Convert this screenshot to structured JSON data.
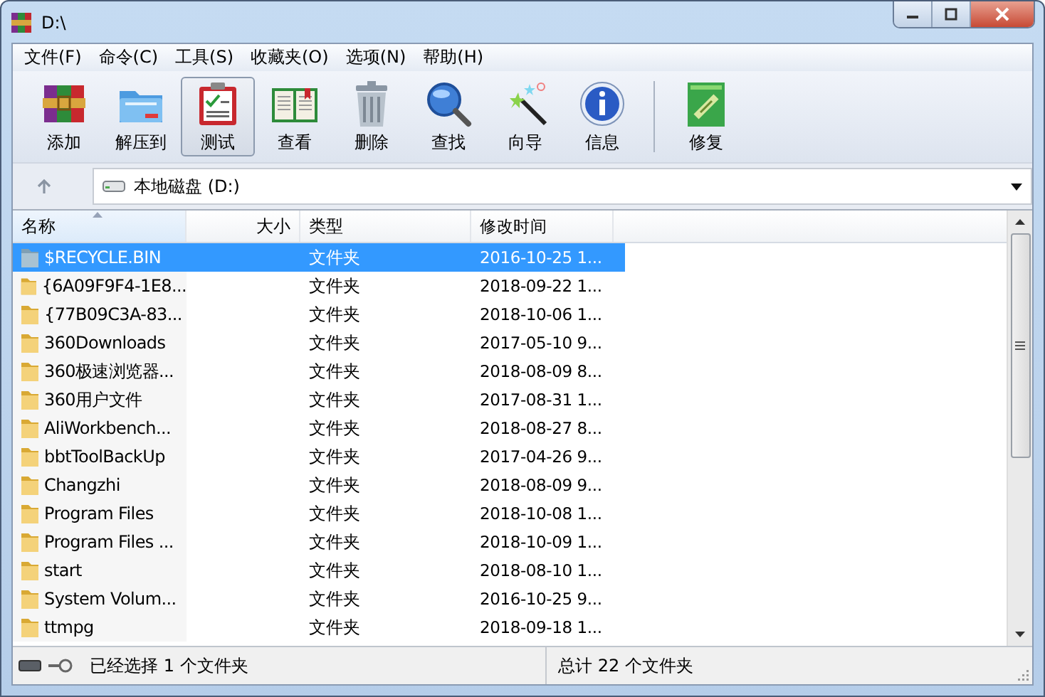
{
  "window": {
    "title": "D:\\"
  },
  "menu": [
    "文件(F)",
    "命令(C)",
    "工具(S)",
    "收藏夹(O)",
    "选项(N)",
    "帮助(H)"
  ],
  "toolbar": [
    {
      "label": "添加",
      "kind": "add",
      "selected": false
    },
    {
      "label": "解压到",
      "kind": "extract",
      "selected": false
    },
    {
      "label": "测试",
      "kind": "test",
      "selected": true
    },
    {
      "label": "查看",
      "kind": "view",
      "selected": false
    },
    {
      "label": "删除",
      "kind": "delete",
      "selected": false
    },
    {
      "label": "查找",
      "kind": "find",
      "selected": false
    },
    {
      "label": "向导",
      "kind": "wizard",
      "selected": false
    },
    {
      "label": "信息",
      "kind": "info",
      "selected": false
    },
    {
      "label": "修复",
      "kind": "repair",
      "selected": false
    }
  ],
  "address": {
    "value": "本地磁盘 (D:)"
  },
  "table": {
    "columns": [
      {
        "label": "名称",
        "sorted": true
      },
      {
        "label": "大小",
        "sorted": false
      },
      {
        "label": "类型",
        "sorted": false
      },
      {
        "label": "修改时间",
        "sorted": false
      }
    ],
    "rows": [
      {
        "name": "$RECYCLE.BIN",
        "kind": "recycle",
        "type": "文件夹",
        "modified": "2016-10-25 1...",
        "selected": true
      },
      {
        "name": "{6A09F9F4-1E8...",
        "kind": "folder",
        "type": "文件夹",
        "modified": "2018-09-22 1...",
        "selected": false
      },
      {
        "name": "{77B09C3A-83...",
        "kind": "folder",
        "type": "文件夹",
        "modified": "2018-10-06 1...",
        "selected": false
      },
      {
        "name": "360Downloads",
        "kind": "folder",
        "type": "文件夹",
        "modified": "2017-05-10 9...",
        "selected": false
      },
      {
        "name": "360极速浏览器...",
        "kind": "folder",
        "type": "文件夹",
        "modified": "2018-08-09 8...",
        "selected": false
      },
      {
        "name": "360用户文件",
        "kind": "folder",
        "type": "文件夹",
        "modified": "2017-08-31 1...",
        "selected": false
      },
      {
        "name": "AliWorkbench...",
        "kind": "folder",
        "type": "文件夹",
        "modified": "2018-08-27 8...",
        "selected": false
      },
      {
        "name": "bbtToolBackUp",
        "kind": "folder",
        "type": "文件夹",
        "modified": "2017-04-26 9...",
        "selected": false
      },
      {
        "name": "Changzhi",
        "kind": "folder",
        "type": "文件夹",
        "modified": "2018-08-09 9...",
        "selected": false
      },
      {
        "name": "Program Files",
        "kind": "folder",
        "type": "文件夹",
        "modified": "2018-10-08 1...",
        "selected": false
      },
      {
        "name": "Program Files ...",
        "kind": "folder",
        "type": "文件夹",
        "modified": "2018-10-09 1...",
        "selected": false
      },
      {
        "name": "start",
        "kind": "folder",
        "type": "文件夹",
        "modified": "2018-08-10 1...",
        "selected": false
      },
      {
        "name": "System Volum...",
        "kind": "folder",
        "type": "文件夹",
        "modified": "2016-10-25 9...",
        "selected": false
      },
      {
        "name": "ttmpg",
        "kind": "folder",
        "type": "文件夹",
        "modified": "2018-09-18 1...",
        "selected": false
      }
    ]
  },
  "status_bar": {
    "selection": "已经选择 1 个文件夹",
    "total": "总计 22 个文件夹"
  }
}
